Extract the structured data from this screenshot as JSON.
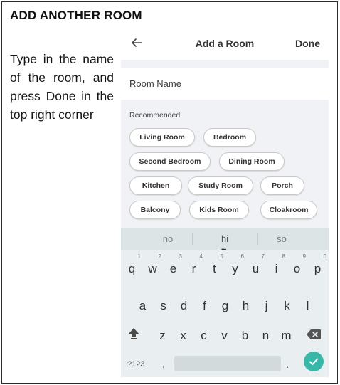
{
  "page": {
    "heading": "ADD ANOTHER ROOM",
    "instruction": "Type in the name of the room, and press Done in the top right corner"
  },
  "app": {
    "title": "Add a Room",
    "done_label": "Done",
    "back_icon": "arrow-left-icon",
    "room_name": {
      "placeholder": "Room Name",
      "value": ""
    },
    "recommended_label": "Recommended",
    "recommended_rooms": [
      "Living Room",
      "Bedroom",
      "Second Bedroom",
      "Dining Room",
      "Kitchen",
      "Study Room",
      "Porch",
      "Balcony",
      "Kids Room",
      "Cloakroom"
    ]
  },
  "keyboard": {
    "suggestions": [
      "no",
      "hi",
      "so"
    ],
    "numbers": [
      "1",
      "2",
      "3",
      "4",
      "5",
      "6",
      "7",
      "8",
      "9",
      "0"
    ],
    "row1": [
      "q",
      "w",
      "e",
      "r",
      "t",
      "y",
      "u",
      "i",
      "o",
      "p"
    ],
    "row2": [
      "a",
      "s",
      "d",
      "f",
      "g",
      "h",
      "j",
      "k",
      "l"
    ],
    "row3": [
      "z",
      "x",
      "c",
      "v",
      "b",
      "n",
      "m"
    ],
    "symbols_label": "?123",
    "comma": ",",
    "period": ".",
    "enter_color": "#37b8a8"
  }
}
